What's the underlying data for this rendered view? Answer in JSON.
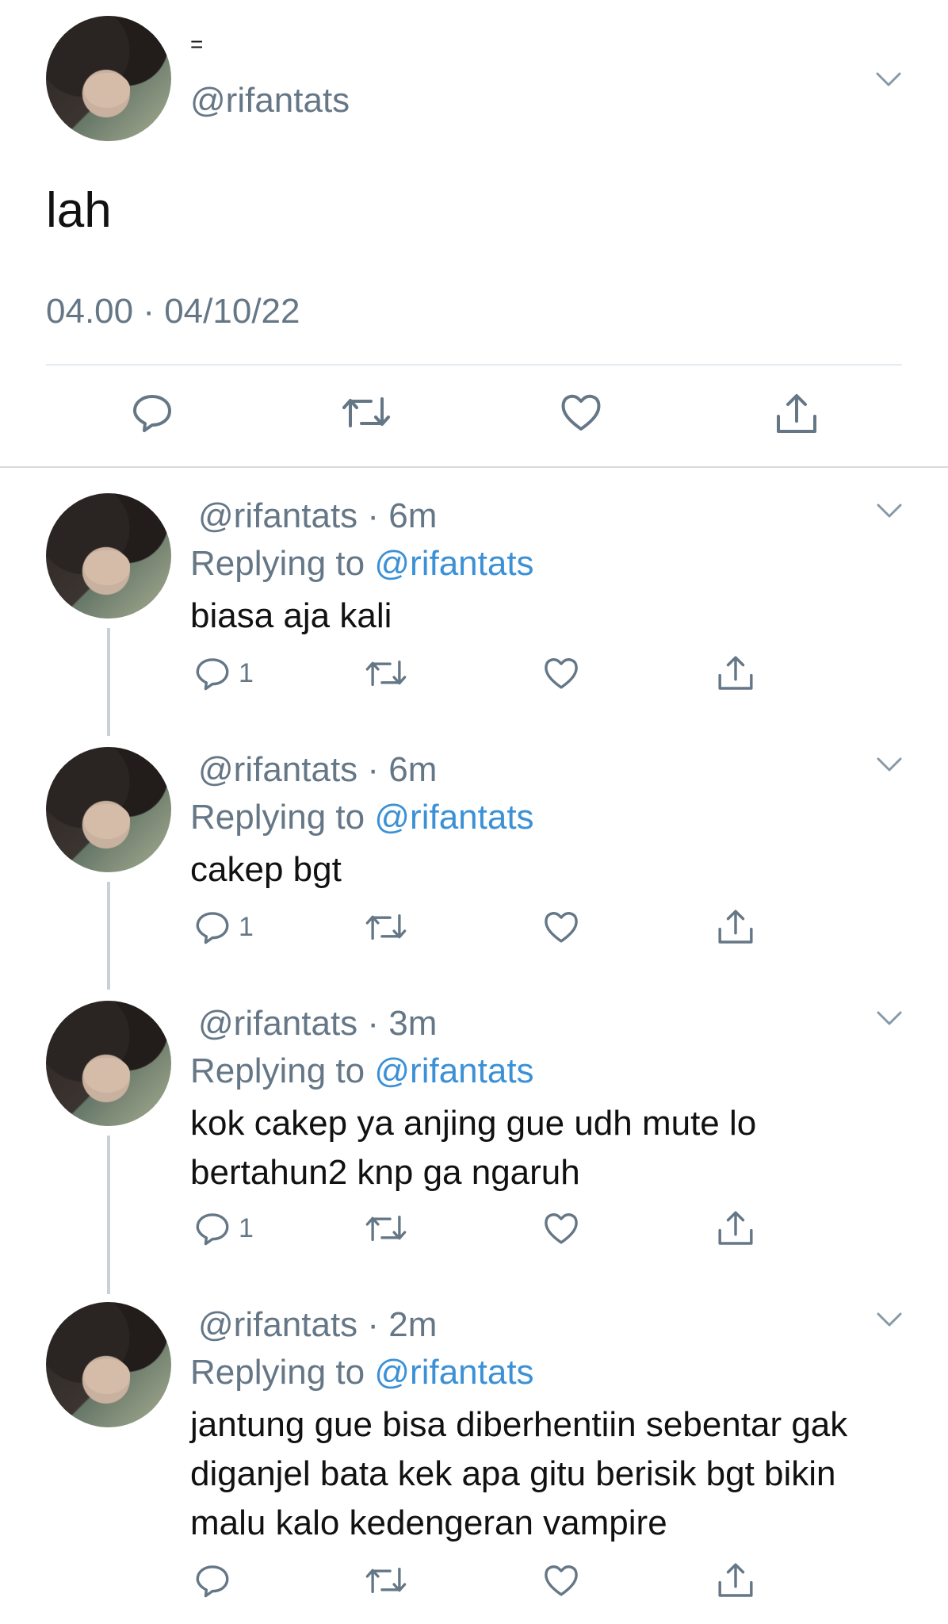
{
  "main_tweet": {
    "display_name": "=",
    "handle": "@rifantats",
    "text": "lah",
    "timestamp": "04.00 · 04/10/22"
  },
  "replies": [
    {
      "handle": "@rifantats",
      "time": "· 6m",
      "replying_label": "Replying to",
      "replying_to": "@rifantats",
      "text": "biasa aja kali",
      "reply_count": "1"
    },
    {
      "handle": "@rifantats",
      "time": "· 6m",
      "replying_label": "Replying to",
      "replying_to": "@rifantats",
      "text": "cakep bgt",
      "reply_count": "1"
    },
    {
      "handle": "@rifantats",
      "time": "· 3m",
      "replying_label": "Replying to",
      "replying_to": "@rifantats",
      "text": "kok cakep ya anjing gue udh mute lo bertahun2 knp ga ngaruh",
      "reply_count": "1"
    },
    {
      "handle": "@rifantats",
      "time": "· 2m",
      "replying_label": "Replying to",
      "replying_to": "@rifantats",
      "text": "jantung gue bisa diberhentiin sebentar gak diganjel bata kek apa gitu berisik bgt bikin malu kalo kedengeran vampire",
      "reply_count": ""
    }
  ],
  "icons": {
    "reply": "speech-bubble-icon",
    "retweet": "retweet-icon",
    "like": "heart-icon",
    "share": "share-icon",
    "more": "chevron-down-icon"
  },
  "colors": {
    "link": "#3c91d6",
    "secondary_text": "#657786",
    "divider": "#e6ecf0"
  }
}
